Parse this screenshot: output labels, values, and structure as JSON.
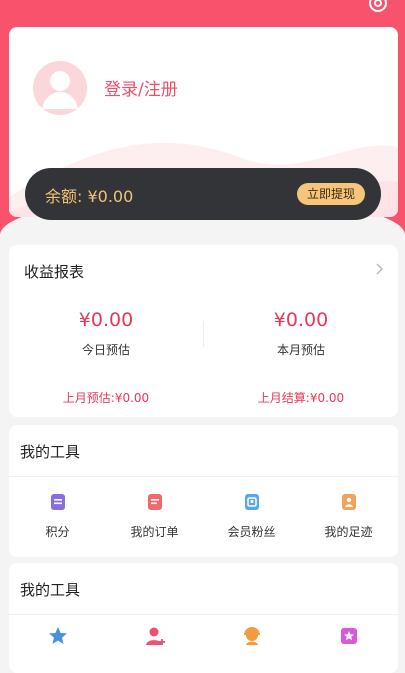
{
  "profile": {
    "login_label": "登录/注册"
  },
  "balance": {
    "text": "余额: ¥0.00",
    "withdraw_label": "立即提现"
  },
  "earnings": {
    "title": "收益报表",
    "today": {
      "value": "¥0.00",
      "label": "今日预估"
    },
    "month": {
      "value": "¥0.00",
      "label": "本月预估"
    },
    "last_month_estimate": "上月预估:¥0.00",
    "last_month_settled": "上月结算:¥0.00"
  },
  "tools1": {
    "title": "我的工具",
    "items": [
      {
        "label": "积分",
        "icon": "points-icon"
      },
      {
        "label": "我的订单",
        "icon": "order-icon"
      },
      {
        "label": "会员粉丝",
        "icon": "fans-icon"
      },
      {
        "label": "我的足迹",
        "icon": "footprint-icon"
      }
    ]
  },
  "tools2": {
    "title": "我的工具",
    "items": [
      {
        "icon": "star-icon"
      },
      {
        "icon": "add-user-icon"
      },
      {
        "icon": "support-icon"
      },
      {
        "icon": "gift-icon"
      }
    ]
  },
  "colors": {
    "brand": "#f9526d",
    "accent_text": "#e8385a",
    "gold": "#f6c47a",
    "dark_bar": "#333438"
  }
}
